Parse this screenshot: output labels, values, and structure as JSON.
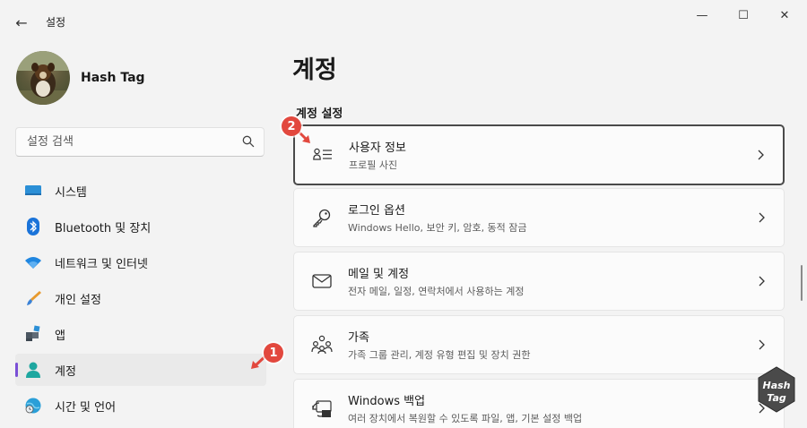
{
  "window": {
    "title": "설정",
    "back_glyph": "←",
    "minimize_glyph": "—",
    "maximize_glyph": "☐",
    "close_glyph": "✕"
  },
  "profile": {
    "name": "Hash Tag"
  },
  "search": {
    "placeholder": "설정 검색"
  },
  "nav": {
    "items": [
      {
        "label": "시스템",
        "icon": "system-icon"
      },
      {
        "label": "Bluetooth 및 장치",
        "icon": "bluetooth-icon"
      },
      {
        "label": "네트워크 및 인터넷",
        "icon": "wifi-icon"
      },
      {
        "label": "개인 설정",
        "icon": "brush-icon"
      },
      {
        "label": "앱",
        "icon": "apps-icon"
      },
      {
        "label": "계정",
        "icon": "person-icon",
        "active": true
      },
      {
        "label": "시간 및 언어",
        "icon": "globe-clock-icon"
      }
    ]
  },
  "main": {
    "title": "계정",
    "section": "계정 설정",
    "cards": [
      {
        "title": "사용자 정보",
        "subtitle": "프로필 사진",
        "icon": "user-info-icon",
        "selected": true
      },
      {
        "title": "로그인 옵션",
        "subtitle": "Windows Hello, 보안 키, 암호, 동적 잠금",
        "icon": "key-icon"
      },
      {
        "title": "메일 및 계정",
        "subtitle": "전자 메일, 일정, 연락처에서 사용하는 계정",
        "icon": "mail-icon"
      },
      {
        "title": "가족",
        "subtitle": "가족 그룹 관리, 계정 유형 편집 및 장치 권한",
        "icon": "family-icon"
      },
      {
        "title": "Windows 백업",
        "subtitle": "여러 장치에서 복원할 수 있도록 파일, 앱, 기본 설정 백업",
        "icon": "backup-icon"
      }
    ]
  },
  "annotations": {
    "badge_1": "1",
    "badge_2": "2"
  },
  "watermark": {
    "line1": "Hash",
    "line2": "Tag"
  },
  "colors": {
    "accent": "#7a4fd6",
    "badge": "#e2483e",
    "background": "#f3f3f3"
  }
}
